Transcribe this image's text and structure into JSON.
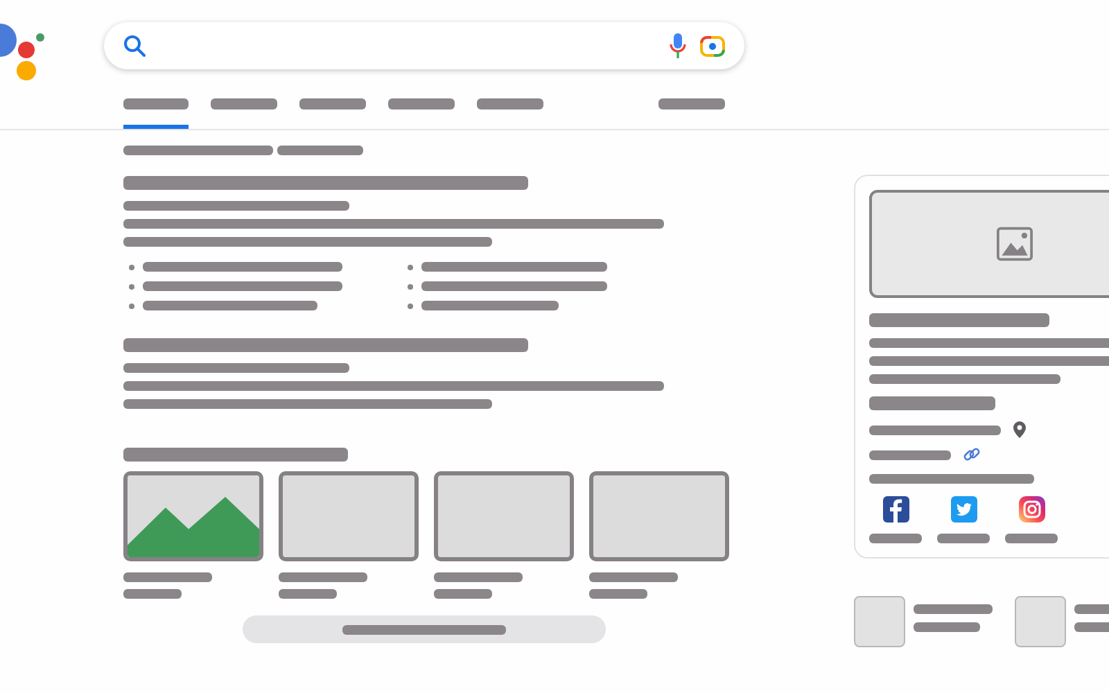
{
  "tabs": [
    {
      "selected": true
    },
    {
      "selected": false
    },
    {
      "selected": false
    },
    {
      "selected": false
    },
    {
      "selected": false
    },
    {
      "selected": false
    }
  ],
  "image_results": [
    {
      "kind": "picture"
    },
    {
      "kind": "blank"
    },
    {
      "kind": "blank"
    },
    {
      "kind": "blank"
    }
  ]
}
